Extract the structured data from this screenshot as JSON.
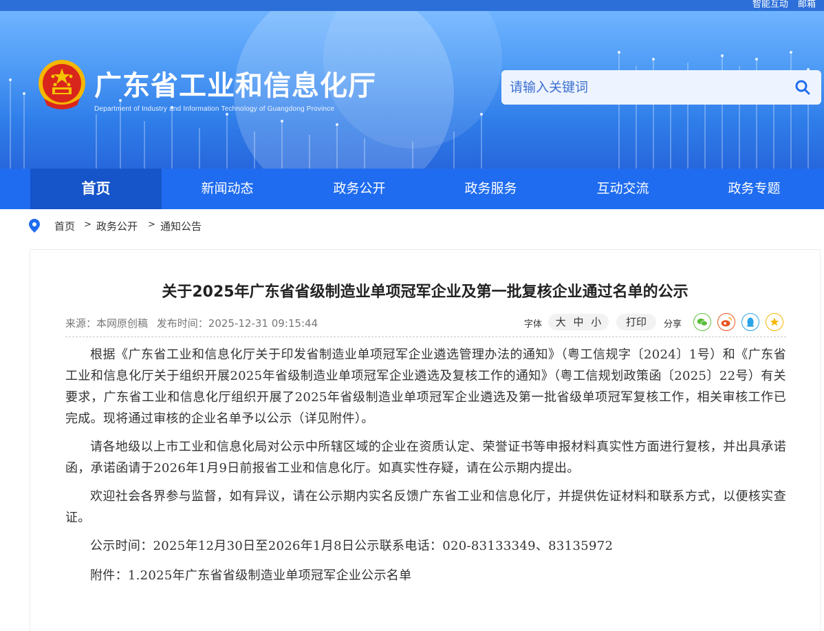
{
  "topbar": {
    "links": [
      "智能互动",
      "邮箱"
    ]
  },
  "header": {
    "title": "广东省工业和信息化厅",
    "subtitle": "Department of Industry and Information Technology of Guangdong Province",
    "search": {
      "placeholder": "请输入关键词"
    }
  },
  "nav": {
    "items": [
      "首页",
      "新闻动态",
      "政务公开",
      "政务服务",
      "互动交流",
      "政务专题"
    ],
    "active": "首页"
  },
  "breadcrumb": {
    "items": [
      "首页",
      "政务公开",
      "通知公告"
    ],
    "separator": ">"
  },
  "article": {
    "title": "关于2025年广东省省级制造业单项冠军企业及第一批复核企业通过名单的公示",
    "source": "来源：本网原创稿",
    "publish_time": "发布时间：2025-12-31 09:15:44",
    "font_label": "字体",
    "font_sizes": [
      "大",
      "中",
      "小"
    ],
    "print_label": "打印",
    "share_label": "分享",
    "share_icons": [
      "wechat-icon",
      "weibo-icon",
      "qq-icon",
      "favorite-icon"
    ],
    "paragraphs": [
      "根据《广东省工业和信息化厅关于印发省制造业单项冠军企业遴选管理办法的通知》（粤工信规字〔2024〕1号）和《广东省工业和信息化厅关于组织开展2025年省级制造业单项冠军企业遴选及复核工作的通知》（粤工信规划政策函〔2025〕22号）有关要求，广东省工业和信息化厅组织开展了2025年省级制造业单项冠军企业遴选及第一批省级单项冠军复核工作，相关审核工作已完成。现将通过审核的企业名单予以公示（详见附件）。",
      "请各地级以上市工业和信息化局对公示中所辖区域的企业在资质认定、荣誉证书等申报材料真实性方面进行复核，并出具承诺函，承诺函请于2026年1月9日前报省工业和信息化厅。如真实性存疑，请在公示期内提出。",
      "欢迎社会各界参与监督，如有异议，请在公示期内实名反馈广东省工业和信息化厅，并提供佐证材料和联系方式，以便核实查证。",
      "公示时间：2025年12月30日至2026年1月8日公示联系电话：020-83133349、83135972",
      "附件：1.2025年广东省省级制造业单项冠军企业公示名单"
    ]
  },
  "colors": {
    "nav_bg": "#1f6cf0",
    "nav_active": "#1554c9",
    "header_top": "#6fb4ff",
    "header_bottom": "#2767dc"
  }
}
